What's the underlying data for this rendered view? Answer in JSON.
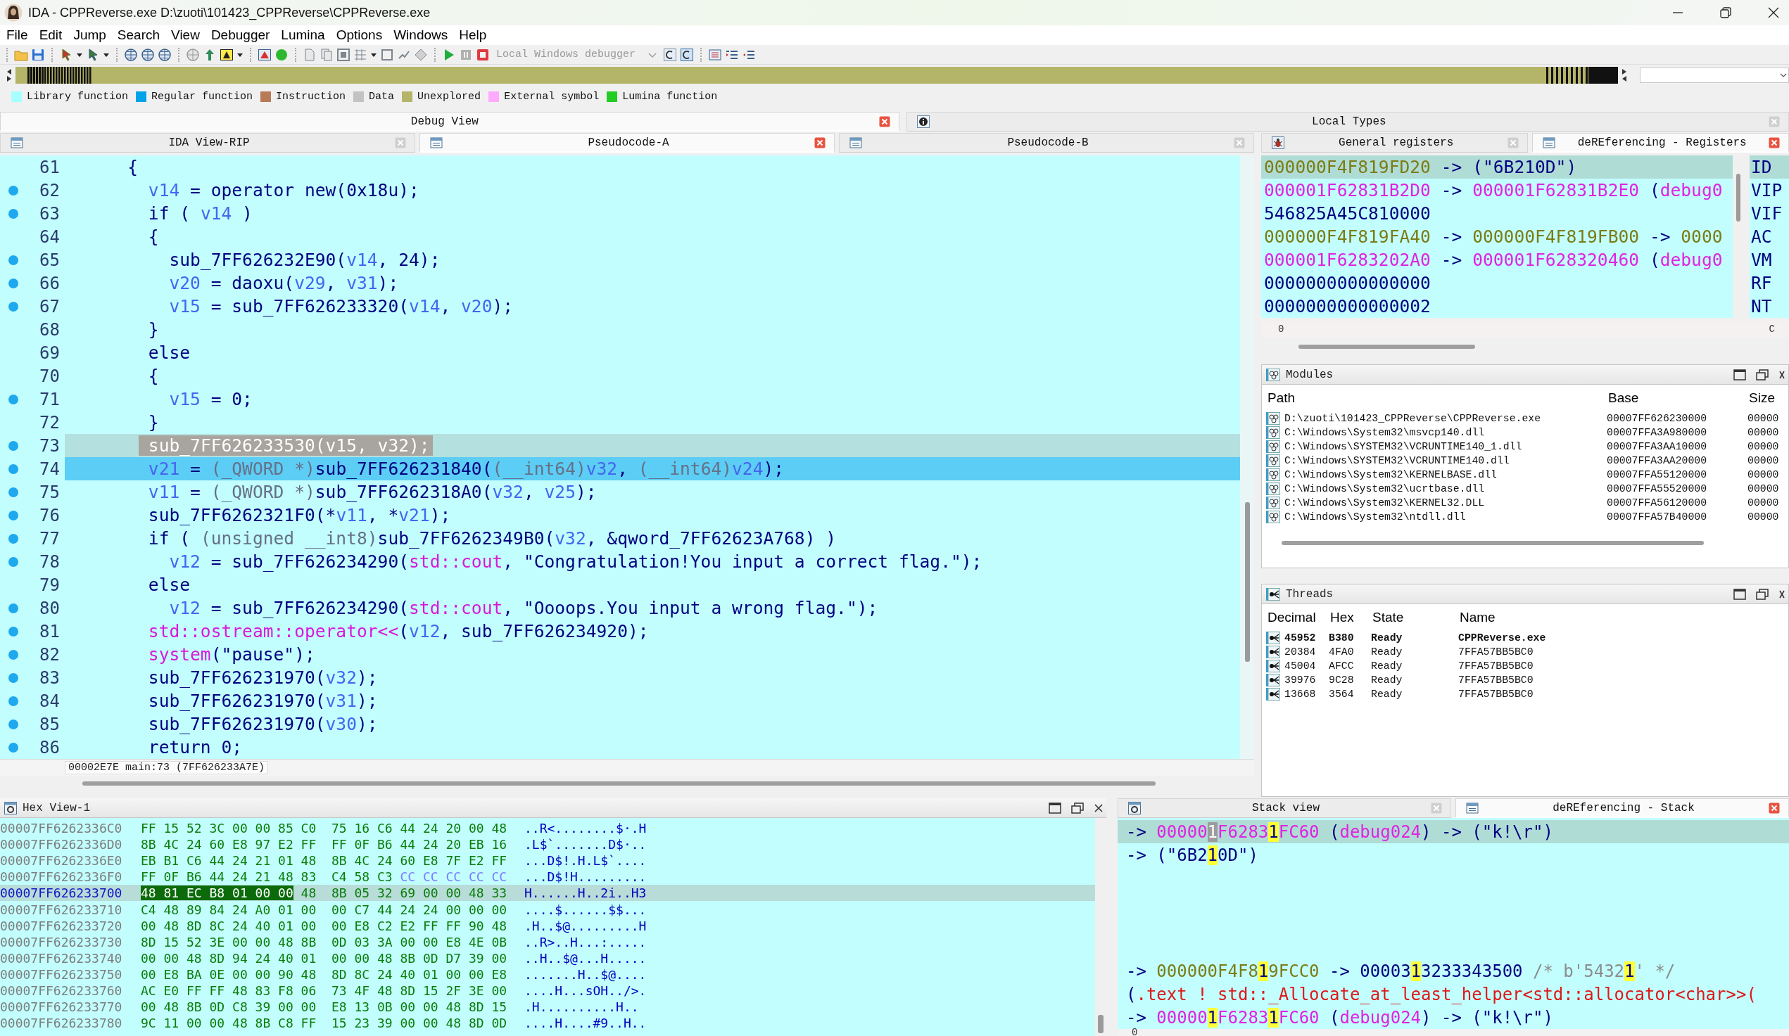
{
  "window": {
    "title": "IDA - CPPReverse.exe D:\\zuoti\\101423_CPPReverse\\CPPReverse.exe"
  },
  "menu": [
    "File",
    "Edit",
    "Jump",
    "Search",
    "View",
    "Debugger",
    "Lumina",
    "Options",
    "Windows",
    "Help"
  ],
  "toolbar": {
    "debugger_select": {
      "value": "Local Windows debugger",
      "disabled": true
    }
  },
  "legend": [
    {
      "label": "Library function",
      "color": "#a8ffff"
    },
    {
      "label": "Regular function",
      "color": "#00a2e8"
    },
    {
      "label": "Instruction",
      "color": "#b97a57"
    },
    {
      "label": "Data",
      "color": "#c3c3c3"
    },
    {
      "label": "Unexplored",
      "color": "#b5b56a"
    },
    {
      "label": "External symbol",
      "color": "#ffaaff"
    },
    {
      "label": "Lumina function",
      "color": "#22cc22"
    }
  ],
  "dock_tabs": [
    {
      "label": "Debug View",
      "selected": true
    },
    {
      "label": "Local Types",
      "selected": false
    }
  ],
  "code_view": {
    "tabs": [
      {
        "label": "IDA View-RIP",
        "selected": false
      },
      {
        "label": "Pseudocode-A",
        "selected": true
      },
      {
        "label": "Pseudocode-B",
        "selected": false
      }
    ],
    "lines": [
      {
        "number": "61",
        "dot": false,
        "selected": false,
        "current": false,
        "tokens": [
          {
            "text": "    {",
            "kind": "text"
          }
        ]
      },
      {
        "number": "62",
        "dot": true,
        "selected": false,
        "current": false,
        "tokens": [
          {
            "text": "      v14",
            "kind": "var"
          },
          {
            "text": " = operator new(0x18u);",
            "kind": "text"
          }
        ]
      },
      {
        "number": "63",
        "dot": true,
        "selected": false,
        "current": false,
        "tokens": [
          {
            "text": "      if ( ",
            "kind": "text"
          },
          {
            "text": "v14",
            "kind": "var"
          },
          {
            "text": " )",
            "kind": "text"
          }
        ]
      },
      {
        "number": "64",
        "dot": false,
        "selected": false,
        "current": false,
        "tokens": [
          {
            "text": "      {",
            "kind": "text"
          }
        ]
      },
      {
        "number": "65",
        "dot": true,
        "selected": false,
        "current": false,
        "tokens": [
          {
            "text": "        sub_7FF626232E90(",
            "kind": "text"
          },
          {
            "text": "v14",
            "kind": "var"
          },
          {
            "text": ", 24);",
            "kind": "text"
          }
        ]
      },
      {
        "number": "66",
        "dot": true,
        "selected": false,
        "current": false,
        "tokens": [
          {
            "text": "        v20",
            "kind": "var"
          },
          {
            "text": " = daoxu(",
            "kind": "text"
          },
          {
            "text": "v29",
            "kind": "var"
          },
          {
            "text": ", ",
            "kind": "text"
          },
          {
            "text": "v31",
            "kind": "var"
          },
          {
            "text": ");",
            "kind": "text"
          }
        ]
      },
      {
        "number": "67",
        "dot": true,
        "selected": false,
        "current": false,
        "tokens": [
          {
            "text": "        v15",
            "kind": "var"
          },
          {
            "text": " = sub_7FF626233320(",
            "kind": "text"
          },
          {
            "text": "v14",
            "kind": "var"
          },
          {
            "text": ", ",
            "kind": "text"
          },
          {
            "text": "v20",
            "kind": "var"
          },
          {
            "text": ");",
            "kind": "text"
          }
        ]
      },
      {
        "number": "68",
        "dot": false,
        "selected": false,
        "current": false,
        "tokens": [
          {
            "text": "      }",
            "kind": "text"
          }
        ]
      },
      {
        "number": "69",
        "dot": false,
        "selected": false,
        "current": false,
        "tokens": [
          {
            "text": "      else",
            "kind": "text"
          }
        ]
      },
      {
        "number": "70",
        "dot": false,
        "selected": false,
        "current": false,
        "tokens": [
          {
            "text": "      {",
            "kind": "text"
          }
        ]
      },
      {
        "number": "71",
        "dot": true,
        "selected": false,
        "current": false,
        "tokens": [
          {
            "text": "        v15",
            "kind": "var"
          },
          {
            "text": " = 0;",
            "kind": "text"
          }
        ]
      },
      {
        "number": "72",
        "dot": false,
        "selected": false,
        "current": false,
        "tokens": [
          {
            "text": "      }",
            "kind": "text"
          }
        ]
      },
      {
        "number": "73",
        "dot": true,
        "selected": true,
        "current": false,
        "tokens": [
          {
            "text": "      sub_7FF626233530(",
            "kind": "text"
          },
          {
            "text": "v15",
            "kind": "var"
          },
          {
            "text": ", ",
            "kind": "text"
          },
          {
            "text": "v32",
            "kind": "var"
          },
          {
            "text": ");",
            "kind": "text"
          }
        ]
      },
      {
        "number": "74",
        "dot": true,
        "selected": false,
        "current": true,
        "tokens": [
          {
            "text": "      v21",
            "kind": "var"
          },
          {
            "text": " = ",
            "kind": "text"
          },
          {
            "text": "(_QWORD *)",
            "kind": "cast"
          },
          {
            "text": "sub_7FF626231840(",
            "kind": "text"
          },
          {
            "text": "(__int64)",
            "kind": "cast"
          },
          {
            "text": "v32",
            "kind": "var"
          },
          {
            "text": ", ",
            "kind": "text"
          },
          {
            "text": "(__int64)",
            "kind": "cast"
          },
          {
            "text": "v24",
            "kind": "var"
          },
          {
            "text": ");",
            "kind": "text"
          }
        ]
      },
      {
        "number": "75",
        "dot": true,
        "selected": false,
        "current": false,
        "tokens": [
          {
            "text": "      v11",
            "kind": "var"
          },
          {
            "text": " = ",
            "kind": "text"
          },
          {
            "text": "(_QWORD *)",
            "kind": "cast"
          },
          {
            "text": "sub_7FF6262318A0(",
            "kind": "text"
          },
          {
            "text": "v32",
            "kind": "var"
          },
          {
            "text": ", ",
            "kind": "text"
          },
          {
            "text": "v25",
            "kind": "var"
          },
          {
            "text": ");",
            "kind": "text"
          }
        ]
      },
      {
        "number": "76",
        "dot": true,
        "selected": false,
        "current": false,
        "tokens": [
          {
            "text": "      sub_7FF6262321F0(*",
            "kind": "text"
          },
          {
            "text": "v11",
            "kind": "var"
          },
          {
            "text": ", *",
            "kind": "text"
          },
          {
            "text": "v21",
            "kind": "var"
          },
          {
            "text": ");",
            "kind": "text"
          }
        ]
      },
      {
        "number": "77",
        "dot": true,
        "selected": false,
        "current": false,
        "tokens": [
          {
            "text": "      if ( ",
            "kind": "text"
          },
          {
            "text": "(unsigned __int8)",
            "kind": "cast"
          },
          {
            "text": "sub_7FF6262349B0(",
            "kind": "text"
          },
          {
            "text": "v32",
            "kind": "var"
          },
          {
            "text": ", &qword_7FF62623A768) )",
            "kind": "text"
          }
        ]
      },
      {
        "number": "78",
        "dot": true,
        "selected": false,
        "current": false,
        "tokens": [
          {
            "text": "        v12",
            "kind": "var"
          },
          {
            "text": " = sub_7FF626234290(",
            "kind": "text"
          },
          {
            "text": "std::cout",
            "kind": "import"
          },
          {
            "text": ", \"Congratulation!You input a correct flag.\");",
            "kind": "text"
          }
        ]
      },
      {
        "number": "79",
        "dot": false,
        "selected": false,
        "current": false,
        "tokens": [
          {
            "text": "      else",
            "kind": "text"
          }
        ]
      },
      {
        "number": "80",
        "dot": true,
        "selected": false,
        "current": false,
        "tokens": [
          {
            "text": "        v12",
            "kind": "var"
          },
          {
            "text": " = sub_7FF626234290(",
            "kind": "text"
          },
          {
            "text": "std::cout",
            "kind": "import"
          },
          {
            "text": ", \"Oooops.You input a wrong flag.\");",
            "kind": "text"
          }
        ]
      },
      {
        "number": "81",
        "dot": true,
        "selected": false,
        "current": false,
        "tokens": [
          {
            "text": "      std::ostream::operator<<",
            "kind": "import"
          },
          {
            "text": "(",
            "kind": "text"
          },
          {
            "text": "v12",
            "kind": "var"
          },
          {
            "text": ", sub_7FF626234920);",
            "kind": "text"
          }
        ]
      },
      {
        "number": "82",
        "dot": true,
        "selected": false,
        "current": false,
        "tokens": [
          {
            "text": "      system",
            "kind": "import"
          },
          {
            "text": "(\"pause\");",
            "kind": "text"
          }
        ]
      },
      {
        "number": "83",
        "dot": true,
        "selected": false,
        "current": false,
        "tokens": [
          {
            "text": "      sub_7FF626231970(",
            "kind": "text"
          },
          {
            "text": "v32",
            "kind": "var"
          },
          {
            "text": ");",
            "kind": "text"
          }
        ]
      },
      {
        "number": "84",
        "dot": true,
        "selected": false,
        "current": false,
        "tokens": [
          {
            "text": "      sub_7FF626231970(",
            "kind": "text"
          },
          {
            "text": "v31",
            "kind": "var"
          },
          {
            "text": ");",
            "kind": "text"
          }
        ]
      },
      {
        "number": "85",
        "dot": true,
        "selected": false,
        "current": false,
        "tokens": [
          {
            "text": "      sub_7FF626231970(",
            "kind": "text"
          },
          {
            "text": "v30",
            "kind": "var"
          },
          {
            "text": ");",
            "kind": "text"
          }
        ]
      },
      {
        "number": "86",
        "dot": true,
        "selected": false,
        "current": false,
        "tokens": [
          {
            "text": "      return 0;",
            "kind": "text"
          }
        ]
      }
    ],
    "status": "00002E7E main:73 (7FF626233A7E)"
  },
  "registers_view": {
    "tabs": [
      {
        "label": "General registers",
        "selected": false
      },
      {
        "label": "deREferencing - Registers",
        "selected": true
      }
    ],
    "rows": [
      {
        "selected": true,
        "segments": [
          {
            "text": "000000F4F819FD20",
            "kind": "stack"
          },
          {
            "text": " -> (\"6B210D\")",
            "kind": "text"
          }
        ]
      },
      {
        "selected": false,
        "segments": [
          {
            "text": "000001F62831B2D0",
            "kind": "debug"
          },
          {
            "text": " -> ",
            "kind": "text"
          },
          {
            "text": "000001F62831B2E0",
            "kind": "debug"
          },
          {
            "text": " (",
            "kind": "text"
          },
          {
            "text": "debug0",
            "kind": "debug"
          }
        ]
      },
      {
        "selected": false,
        "segments": [
          {
            "text": "546825A45C810000",
            "kind": "text"
          }
        ]
      },
      {
        "selected": false,
        "segments": [
          {
            "text": "000000F4F819FA40",
            "kind": "stack"
          },
          {
            "text": " -> ",
            "kind": "text"
          },
          {
            "text": "000000F4F819FB00",
            "kind": "stack"
          },
          {
            "text": " -> ",
            "kind": "text"
          },
          {
            "text": "0000",
            "kind": "stack"
          }
        ]
      },
      {
        "selected": false,
        "segments": [
          {
            "text": "000001F6283202A0",
            "kind": "debug"
          },
          {
            "text": " -> ",
            "kind": "text"
          },
          {
            "text": "000001F628320460",
            "kind": "debug"
          },
          {
            "text": " (",
            "kind": "text"
          },
          {
            "text": "debug0",
            "kind": "debug"
          }
        ]
      },
      {
        "selected": false,
        "segments": [
          {
            "text": "0000000000000000",
            "kind": "text"
          }
        ]
      },
      {
        "selected": false,
        "segments": [
          {
            "text": "0000000000000002",
            "kind": "text"
          }
        ]
      }
    ],
    "flags": [
      {
        "name": "ID",
        "selected": true
      },
      {
        "name": "VIP",
        "selected": false
      },
      {
        "name": "VIF",
        "selected": false
      },
      {
        "name": "AC",
        "selected": false
      },
      {
        "name": "VM",
        "selected": false
      },
      {
        "name": "RF",
        "selected": false
      },
      {
        "name": "NT",
        "selected": false
      }
    ],
    "status": "0",
    "flags_status": "C"
  },
  "modules": {
    "title": "Modules",
    "columns": [
      "Path",
      "Base",
      "Size"
    ],
    "rows": [
      {
        "path": "D:\\zuoti\\101423_CPPReverse\\CPPReverse.exe",
        "base": "00007FF626230000",
        "size": "00000"
      },
      {
        "path": "C:\\Windows\\System32\\msvcp140.dll",
        "base": "00007FFA3A980000",
        "size": "00000"
      },
      {
        "path": "C:\\Windows\\SYSTEM32\\VCRUNTIME140_1.dll",
        "base": "00007FFA3AA10000",
        "size": "00000"
      },
      {
        "path": "C:\\Windows\\SYSTEM32\\VCRUNTIME140.dll",
        "base": "00007FFA3AA20000",
        "size": "00000"
      },
      {
        "path": "C:\\Windows\\System32\\KERNELBASE.dll",
        "base": "00007FFA55120000",
        "size": "00000"
      },
      {
        "path": "C:\\Windows\\System32\\ucrtbase.dll",
        "base": "00007FFA55520000",
        "size": "00000"
      },
      {
        "path": "C:\\Windows\\System32\\KERNEL32.DLL",
        "base": "00007FFA56120000",
        "size": "00000"
      },
      {
        "path": "C:\\Windows\\System32\\ntdll.dll",
        "base": "00007FFA57B40000",
        "size": "00000"
      }
    ]
  },
  "threads": {
    "title": "Threads",
    "columns": [
      "Decimal",
      "Hex",
      "State",
      "Name"
    ],
    "rows": [
      {
        "decimal": "45952",
        "hex": "B380",
        "state": "Ready",
        "name": "CPPReverse.exe",
        "current": true
      },
      {
        "decimal": "20384",
        "hex": "4FA0",
        "state": "Ready",
        "name": "7FFA57BB5BC0",
        "current": false
      },
      {
        "decimal": "45004",
        "hex": "AFCC",
        "state": "Ready",
        "name": "7FFA57BB5BC0",
        "current": false
      },
      {
        "decimal": "39976",
        "hex": "9C28",
        "state": "Ready",
        "name": "7FFA57BB5BC0",
        "current": false
      },
      {
        "decimal": "13668",
        "hex": "3564",
        "state": "Ready",
        "name": "7FFA57BB5BC0",
        "current": false
      }
    ]
  },
  "hex_view": {
    "title": "Hex View-1",
    "rows": [
      {
        "address": "00007FF6262336C0",
        "selected": false,
        "bytes": [
          {
            "text": "FF 15 52 3C 00 00 85 C0  75 16 C6 44 24 20 00 48",
            "kind": "code"
          }
        ],
        "ascii": "..R<........$·.H"
      },
      {
        "address": "00007FF6262336D0",
        "selected": false,
        "bytes": [
          {
            "text": "8B 4C 24 60 E8 97 E2 FF  FF 0F B6 44 24 20 EB 16",
            "kind": "code"
          }
        ],
        "ascii": ".L$`.......D$·.."
      },
      {
        "address": "00007FF6262336E0",
        "selected": false,
        "bytes": [
          {
            "text": "EB B1 C6 44 24 21 01 48  8B 4C 24 60 E8 7F E2 FF",
            "kind": "code"
          }
        ],
        "ascii": "...D$!.H.L$`...."
      },
      {
        "address": "00007FF6262336F0",
        "selected": false,
        "bytes": [
          {
            "text": "FF 0F B6 44 24 21 48 83  C4 58 C3 ",
            "kind": "code"
          },
          {
            "text": "CC CC CC CC CC",
            "kind": "filler"
          }
        ],
        "ascii": "...D$!H........."
      },
      {
        "address": "00007FF626233700",
        "selected": true,
        "bytes": [
          {
            "text": "48 81 EC B8 01 00 00",
            "kind": "selected"
          },
          {
            "text": " 48  8B 05 32 69 00 00 48 33",
            "kind": "code"
          }
        ],
        "ascii": "H......H..2i..H3"
      },
      {
        "address": "00007FF626233710",
        "selected": false,
        "bytes": [
          {
            "text": "C4 48 89 84 24 A0 01 00  00 C7 44 24 24 00 00 00",
            "kind": "code"
          }
        ],
        "ascii": "....$......$$..."
      },
      {
        "address": "00007FF626233720",
        "selected": false,
        "bytes": [
          {
            "text": "00 48 8D 8C 24 40 01 00  00 E8 C2 E2 FF FF 90 48",
            "kind": "code"
          }
        ],
        "ascii": ".H..$@.........H"
      },
      {
        "address": "00007FF626233730",
        "selected": false,
        "bytes": [
          {
            "text": "8D 15 52 3E 00 00 48 8B  0D 03 3A 00 00 E8 4E 0B",
            "kind": "code"
          }
        ],
        "ascii": "..R>..H...:....."
      },
      {
        "address": "00007FF626233740",
        "selected": false,
        "bytes": [
          {
            "text": "00 00 48 8D 94 24 40 01  00 00 48 8B 0D D7 39 00",
            "kind": "code"
          }
        ],
        "ascii": "..H..$@...H....."
      },
      {
        "address": "00007FF626233750",
        "selected": false,
        "bytes": [
          {
            "text": "00 E8 BA 0E 00 00 90 48  8D 8C 24 40 01 00 00 E8",
            "kind": "code"
          }
        ],
        "ascii": ".......H..$@...."
      },
      {
        "address": "00007FF626233760",
        "selected": false,
        "bytes": [
          {
            "text": "AC E0 FF FF 48 83 F8 06  73 4F 48 8D 15 2F 3E 00",
            "kind": "code"
          }
        ],
        "ascii": "....H...sOH../>."
      },
      {
        "address": "00007FF626233770",
        "selected": false,
        "bytes": [
          {
            "text": "00 48 8B 0D C8 39 00 00  E8 13 0B 00 00 48 8D 15",
            "kind": "code"
          }
        ],
        "ascii": ".H..........H.."
      },
      {
        "address": "00007FF626233780",
        "selected": false,
        "bytes": [
          {
            "text": "9C 11 00 00 48 8B C8 FF  15 23 39 00 00 48 8D 0D",
            "kind": "code"
          }
        ],
        "ascii": "....H....#9..H.."
      }
    ]
  },
  "stack_view": {
    "tabs": [
      {
        "label": "Stack view",
        "selected": false
      },
      {
        "label": "deREferencing - Stack",
        "selected": true
      }
    ],
    "groups": [
      {
        "rows": [
          {
            "selected": true,
            "segments": [
              {
                "text": "-> ",
                "kind": "text"
              },
              {
                "text": "00000",
                "kind": "debug"
              },
              {
                "text": "1",
                "kind": "cursor"
              },
              {
                "text": "F6283",
                "kind": "debug"
              },
              {
                "text": "1",
                "kind": "match"
              },
              {
                "text": "FC60",
                "kind": "debug"
              },
              {
                "text": " (",
                "kind": "text"
              },
              {
                "text": "debug024",
                "kind": "debug"
              },
              {
                "text": ") -> (\"k!\\r\")",
                "kind": "text"
              }
            ]
          },
          {
            "selected": false,
            "segments": [
              {
                "text": "-> (\"6B2",
                "kind": "text"
              },
              {
                "text": "1",
                "kind": "match"
              },
              {
                "text": "0D\")",
                "kind": "text"
              }
            ]
          }
        ]
      },
      {
        "rows": [
          {
            "selected": false,
            "segments": [
              {
                "text": "-> ",
                "kind": "text"
              },
              {
                "text": "000000F4F8",
                "kind": "stack"
              },
              {
                "text": "1",
                "kind": "match"
              },
              {
                "text": "9FCC0",
                "kind": "stack"
              },
              {
                "text": " -> 00003",
                "kind": "text"
              },
              {
                "text": "1",
                "kind": "match"
              },
              {
                "text": "3233343500 ",
                "kind": "text"
              },
              {
                "text": "/* b'5432",
                "kind": "comment"
              },
              {
                "text": "1",
                "kind": "match"
              },
              {
                "text": "' */",
                "kind": "comment"
              }
            ]
          },
          {
            "selected": false,
            "segments": [
              {
                "text": "(",
                "kind": "text"
              },
              {
                "text": ".text ! std::_Allocate_at_least_helper<std::allocator<char>>(",
                "kind": "symbol"
              }
            ]
          },
          {
            "selected": false,
            "segments": [
              {
                "text": "-> ",
                "kind": "text"
              },
              {
                "text": "00000",
                "kind": "debug"
              },
              {
                "text": "1",
                "kind": "match"
              },
              {
                "text": "F6283",
                "kind": "debug"
              },
              {
                "text": "1",
                "kind": "match"
              },
              {
                "text": "FC60",
                "kind": "debug"
              },
              {
                "text": " (",
                "kind": "text"
              },
              {
                "text": "debug024",
                "kind": "debug"
              },
              {
                "text": ") -> (\"k!\\r\")",
                "kind": "text"
              }
            ]
          }
        ]
      }
    ],
    "status": "0"
  }
}
